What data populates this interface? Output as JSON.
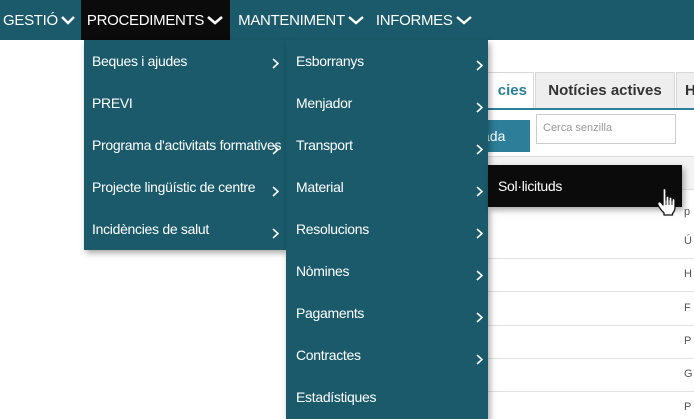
{
  "topbar": {
    "items": [
      {
        "label": "GESTIÓ"
      },
      {
        "label": "PROCEDIMENTS"
      },
      {
        "label": "MANTENIMENT"
      },
      {
        "label": "INFORMES"
      }
    ]
  },
  "background": {
    "tabs": [
      "cies",
      "Notícies actives",
      "H"
    ],
    "button_label": "ada",
    "search_placeholder": "Cerca senzilla",
    "row_fragments": [
      "Ú",
      "H",
      "F",
      "P",
      "G",
      "P"
    ],
    "head_fragment": "p"
  },
  "menu_procediments": {
    "items": [
      {
        "label": "Beques i ajudes",
        "has_submenu": true
      },
      {
        "label": "PREVI",
        "has_submenu": false
      },
      {
        "label": "Programa d'activitats formatives",
        "has_submenu": true
      },
      {
        "label": "Projecte lingüístic de centre",
        "has_submenu": true
      },
      {
        "label": "Incidències de salut",
        "has_submenu": true
      }
    ]
  },
  "menu_submenu": {
    "items": [
      {
        "label": "Esborranys",
        "has_submenu": true
      },
      {
        "label": "Menjador",
        "has_submenu": true
      },
      {
        "label": "Transport",
        "has_submenu": true
      },
      {
        "label": "Material",
        "has_submenu": true
      },
      {
        "label": "Resolucions",
        "has_submenu": true
      },
      {
        "label": "Nòmines",
        "has_submenu": true
      },
      {
        "label": "Pagaments",
        "has_submenu": true
      },
      {
        "label": "Contractes",
        "has_submenu": true
      },
      {
        "label": "Estadístiques",
        "has_submenu": false
      }
    ]
  },
  "menu_material": {
    "items": [
      {
        "label": "Sol·licituds"
      }
    ]
  },
  "colors": {
    "menu_bg": "#1a5a6a",
    "highlight_bg": "#0b0b0b",
    "accent": "#2c7e99"
  }
}
